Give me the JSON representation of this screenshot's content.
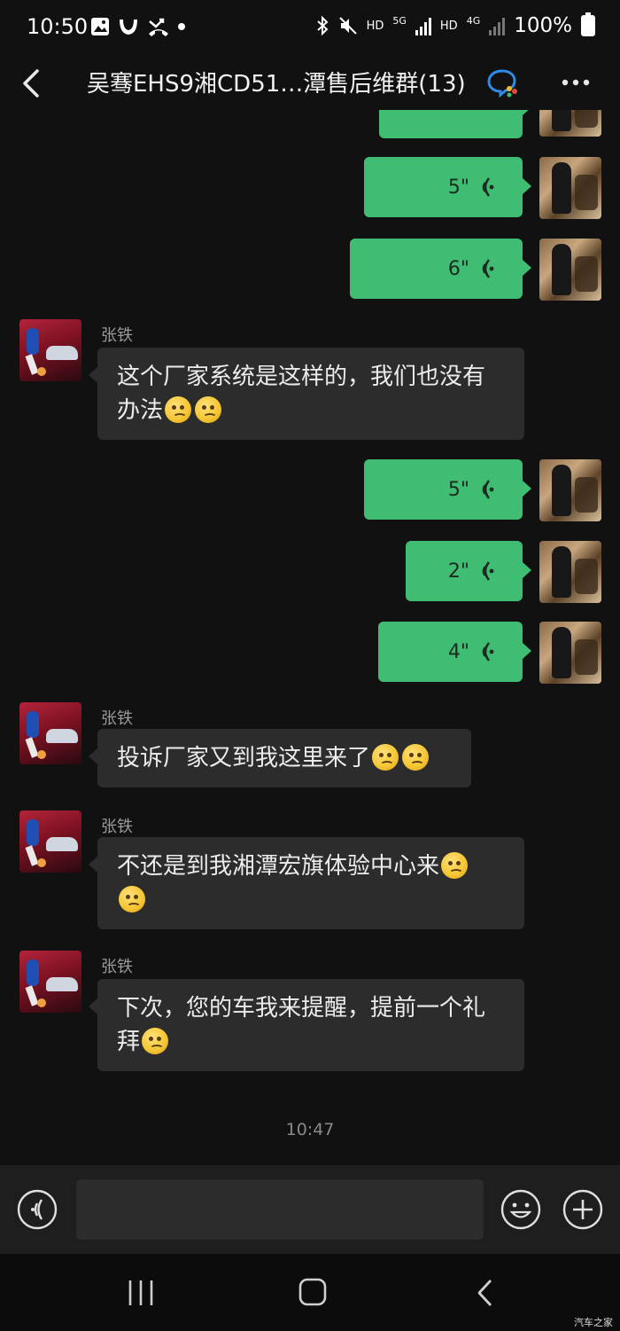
{
  "status_bar": {
    "time": "10:50",
    "network_hd1": "HD",
    "network_5g": "5G",
    "network_hd2": "HD",
    "network_4g": "4G",
    "battery": "100%"
  },
  "header": {
    "title": "吴骞EHS9湘CD51…潭售后维群(13)"
  },
  "messages": {
    "m1": {
      "duration": "5\""
    },
    "m2": {
      "duration": "6\""
    },
    "m3": {
      "sender": "张铁",
      "text_a": "这个厂家系统是这样的，我们也没有",
      "text_b": "办法"
    },
    "m4": {
      "duration": "5\""
    },
    "m5": {
      "duration": "2\""
    },
    "m6": {
      "duration": "4\""
    },
    "m7": {
      "sender": "张铁",
      "text": "投诉厂家又到我这里来了"
    },
    "m8": {
      "sender": "张铁",
      "text": "不还是到我湘潭宏旗体验中心来"
    },
    "m9": {
      "sender": "张铁",
      "text_a": "下次，您的车我来提醒，提前一个礼",
      "text_b": "拜"
    }
  },
  "timestamp": "10:47",
  "watermark": "汽车之家",
  "colors": {
    "background": "#111111",
    "my_bubble": "#3fbd73",
    "other_bubble": "#2c2c2c"
  }
}
